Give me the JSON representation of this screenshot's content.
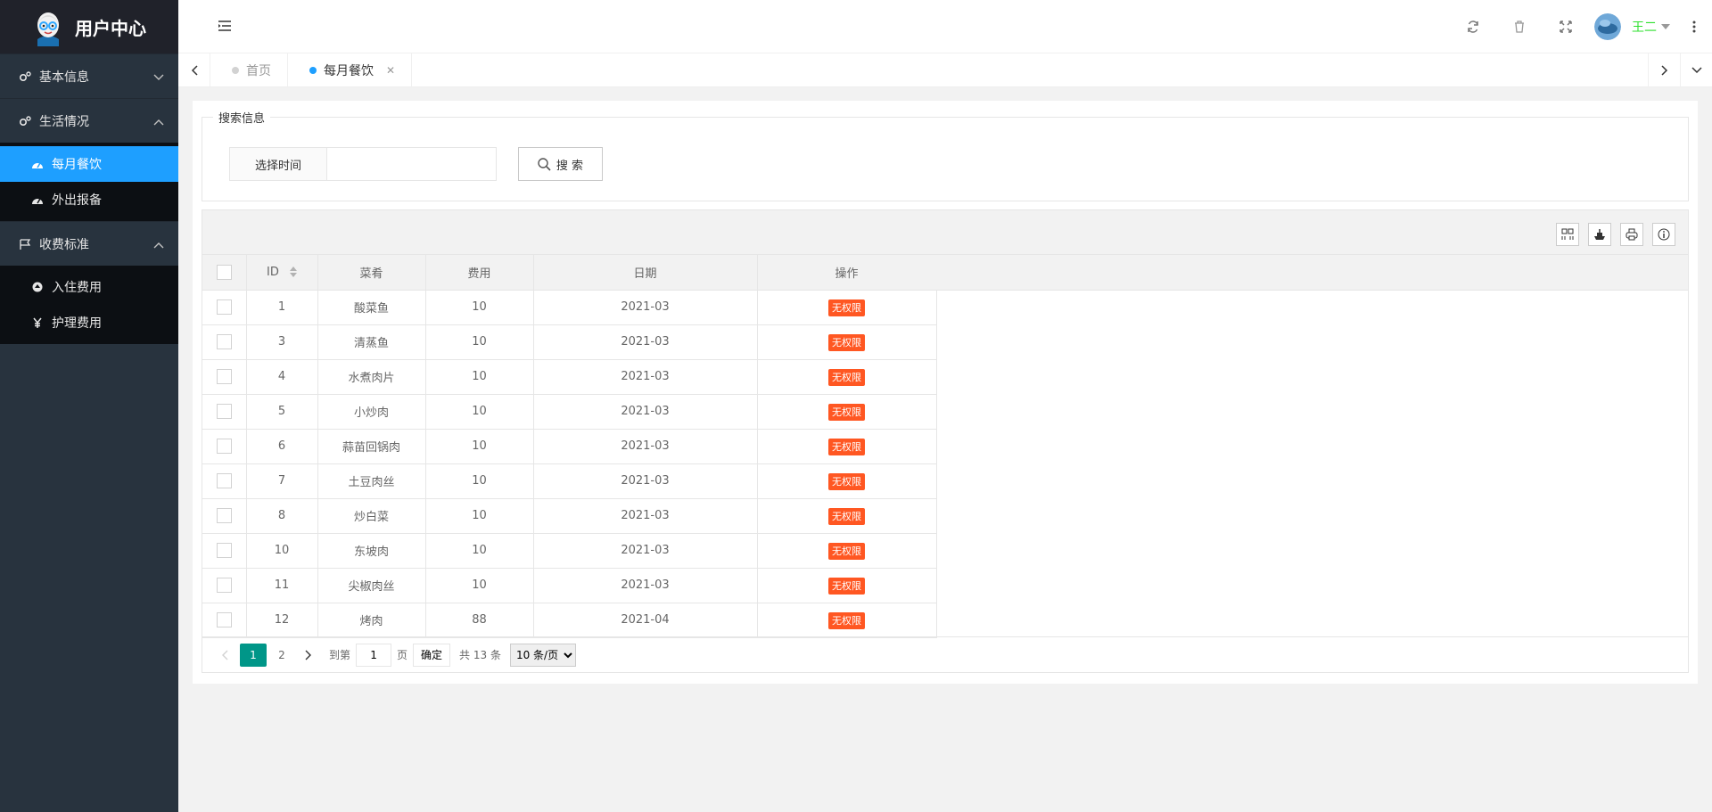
{
  "sidebar": {
    "title": "用户中心",
    "groups": [
      {
        "label": "基本信息",
        "expanded": false,
        "items": []
      },
      {
        "label": "生活情况",
        "expanded": true,
        "items": [
          {
            "label": "每月餐饮",
            "active": true
          },
          {
            "label": "外出报备",
            "active": false
          }
        ]
      },
      {
        "label": "收费标准",
        "expanded": true,
        "items": [
          {
            "label": "入住费用",
            "active": false
          },
          {
            "label": "护理费用",
            "active": false
          }
        ]
      }
    ]
  },
  "header": {
    "user_name": "王二"
  },
  "tabs": [
    {
      "label": "首页",
      "active": false
    },
    {
      "label": "每月餐饮",
      "active": true
    }
  ],
  "search": {
    "legend": "搜索信息",
    "label": "选择时间",
    "value": "",
    "placeholder": "",
    "button": "搜 索"
  },
  "table": {
    "columns": [
      "ID",
      "菜肴",
      "费用",
      "日期",
      "操作"
    ],
    "rows": [
      {
        "id": "1",
        "dish": "酸菜鱼",
        "cost": "10",
        "date": "2021-03",
        "action": "无权限"
      },
      {
        "id": "3",
        "dish": "清蒸鱼",
        "cost": "10",
        "date": "2021-03",
        "action": "无权限"
      },
      {
        "id": "4",
        "dish": "水煮肉片",
        "cost": "10",
        "date": "2021-03",
        "action": "无权限"
      },
      {
        "id": "5",
        "dish": "小炒肉",
        "cost": "10",
        "date": "2021-03",
        "action": "无权限"
      },
      {
        "id": "6",
        "dish": "蒜苗回锅肉",
        "cost": "10",
        "date": "2021-03",
        "action": "无权限"
      },
      {
        "id": "7",
        "dish": "土豆肉丝",
        "cost": "10",
        "date": "2021-03",
        "action": "无权限"
      },
      {
        "id": "8",
        "dish": "炒白菜",
        "cost": "10",
        "date": "2021-03",
        "action": "无权限"
      },
      {
        "id": "10",
        "dish": "东坡肉",
        "cost": "10",
        "date": "2021-03",
        "action": "无权限"
      },
      {
        "id": "11",
        "dish": "尖椒肉丝",
        "cost": "10",
        "date": "2021-03",
        "action": "无权限"
      },
      {
        "id": "12",
        "dish": "烤肉",
        "cost": "88",
        "date": "2021-04",
        "action": "无权限"
      }
    ]
  },
  "pager": {
    "pages": [
      "1",
      "2"
    ],
    "current": "1",
    "goto_label": "到第",
    "goto_value": "1",
    "page_unit": "页",
    "ok": "确定",
    "total": "共 13 条",
    "page_size": "10 条/页"
  },
  "colors": {
    "sidebar_bg": "#28333e",
    "active_blue": "#1e9fff",
    "badge_orange": "#ff5722",
    "pager_green": "#009688",
    "user_green": "#2fe02f"
  }
}
